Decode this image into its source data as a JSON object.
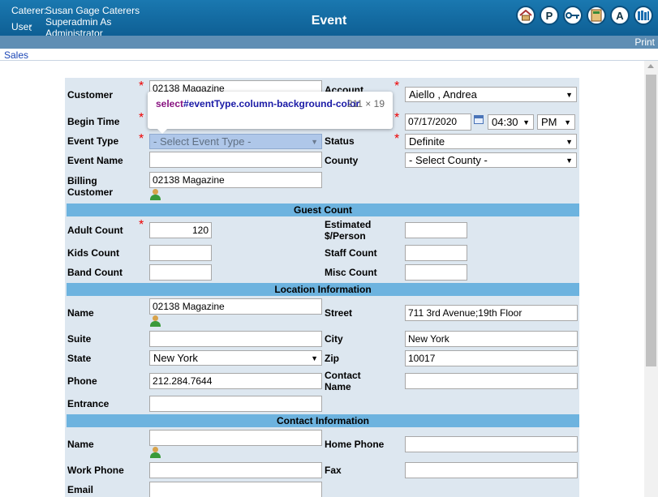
{
  "header": {
    "caterer_key": "Caterer:",
    "caterer_value": "Susan Gage Caterers",
    "user_key": "User",
    "user_colon": ":",
    "user_value": "Superadmin As Administrator",
    "title": "Event",
    "icons": [
      "home-icon",
      "p-icon",
      "key-icon",
      "book-icon",
      "a-icon",
      "library-icon"
    ]
  },
  "print_label": "Print",
  "breadcrumb": "Sales",
  "tooltip": {
    "tag": "select",
    "selector": "#eventType.column-background-color",
    "size": "211 × 19"
  },
  "form": {
    "customer_label": "Customer",
    "customer_value": "02138 Magazine",
    "account_label": "Account",
    "account_value": "Aiello , Andrea",
    "begin_time_label": "Begin Time",
    "date_value": "07/17/2020",
    "hour_value": "04:30",
    "ampm_value": "PM",
    "event_type_label": "Event Type",
    "event_type_value": "- Select Event Type -",
    "status_label": "Status",
    "status_value": "Definite",
    "event_name_label": "Event Name",
    "event_name_value": "",
    "county_label": "County",
    "county_value": "- Select County -",
    "billing_label": "Billing\nCustomer",
    "billing_value": "02138 Magazine"
  },
  "guest": {
    "header": "Guest Count",
    "adult_label": "Adult Count",
    "adult_value": "120",
    "estimated_label": "Estimated\n$/Person",
    "estimated_value": "",
    "kids_label": "Kids Count",
    "kids_value": "",
    "staff_label": "Staff Count",
    "staff_value": "",
    "band_label": "Band Count",
    "band_value": "",
    "misc_label": "Misc Count",
    "misc_value": ""
  },
  "location": {
    "header": "Location Information",
    "name_label": "Name",
    "name_value": "02138 Magazine",
    "street_label": "Street",
    "street_value": "711 3rd Avenue;19th Floor",
    "suite_label": "Suite",
    "suite_value": "",
    "city_label": "City",
    "city_value": "New York",
    "state_label": "State",
    "state_value": "New York",
    "zip_label": "Zip",
    "zip_value": "10017",
    "phone_label": "Phone",
    "phone_value": "212.284.7644",
    "contact_name_label": "Contact\nName",
    "contact_name_value": "",
    "entrance_label": "Entrance",
    "entrance_value": ""
  },
  "contact": {
    "header": "Contact Information",
    "name_label": "Name",
    "name_value": "",
    "home_phone_label": "Home Phone",
    "home_phone_value": "",
    "work_phone_label": "Work Phone",
    "work_phone_value": "",
    "fax_label": "Fax",
    "fax_value": "",
    "email_label": "Email",
    "email_value": ""
  }
}
